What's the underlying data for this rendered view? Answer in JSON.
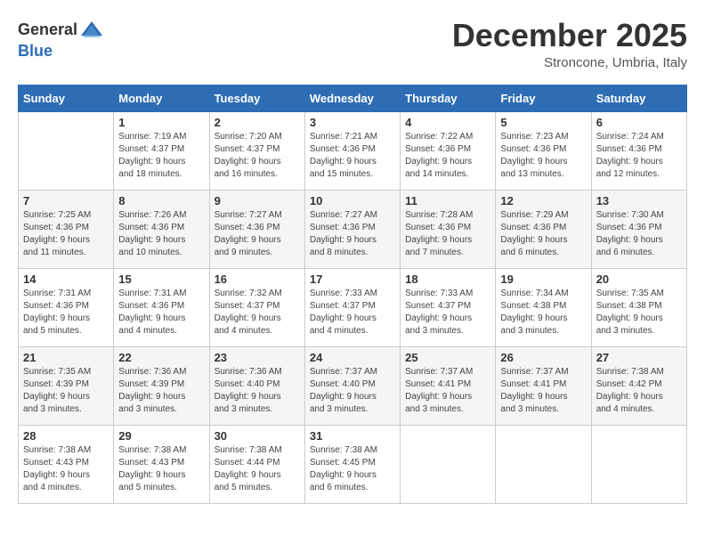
{
  "header": {
    "logo_general": "General",
    "logo_blue": "Blue",
    "month_title": "December 2025",
    "location": "Stroncone, Umbria, Italy"
  },
  "days_of_week": [
    "Sunday",
    "Monday",
    "Tuesday",
    "Wednesday",
    "Thursday",
    "Friday",
    "Saturday"
  ],
  "weeks": [
    [
      {
        "day": "",
        "content": ""
      },
      {
        "day": "1",
        "content": "Sunrise: 7:19 AM\nSunset: 4:37 PM\nDaylight: 9 hours\nand 18 minutes."
      },
      {
        "day": "2",
        "content": "Sunrise: 7:20 AM\nSunset: 4:37 PM\nDaylight: 9 hours\nand 16 minutes."
      },
      {
        "day": "3",
        "content": "Sunrise: 7:21 AM\nSunset: 4:36 PM\nDaylight: 9 hours\nand 15 minutes."
      },
      {
        "day": "4",
        "content": "Sunrise: 7:22 AM\nSunset: 4:36 PM\nDaylight: 9 hours\nand 14 minutes."
      },
      {
        "day": "5",
        "content": "Sunrise: 7:23 AM\nSunset: 4:36 PM\nDaylight: 9 hours\nand 13 minutes."
      },
      {
        "day": "6",
        "content": "Sunrise: 7:24 AM\nSunset: 4:36 PM\nDaylight: 9 hours\nand 12 minutes."
      }
    ],
    [
      {
        "day": "7",
        "content": "Sunrise: 7:25 AM\nSunset: 4:36 PM\nDaylight: 9 hours\nand 11 minutes."
      },
      {
        "day": "8",
        "content": "Sunrise: 7:26 AM\nSunset: 4:36 PM\nDaylight: 9 hours\nand 10 minutes."
      },
      {
        "day": "9",
        "content": "Sunrise: 7:27 AM\nSunset: 4:36 PM\nDaylight: 9 hours\nand 9 minutes."
      },
      {
        "day": "10",
        "content": "Sunrise: 7:27 AM\nSunset: 4:36 PM\nDaylight: 9 hours\nand 8 minutes."
      },
      {
        "day": "11",
        "content": "Sunrise: 7:28 AM\nSunset: 4:36 PM\nDaylight: 9 hours\nand 7 minutes."
      },
      {
        "day": "12",
        "content": "Sunrise: 7:29 AM\nSunset: 4:36 PM\nDaylight: 9 hours\nand 6 minutes."
      },
      {
        "day": "13",
        "content": "Sunrise: 7:30 AM\nSunset: 4:36 PM\nDaylight: 9 hours\nand 6 minutes."
      }
    ],
    [
      {
        "day": "14",
        "content": "Sunrise: 7:31 AM\nSunset: 4:36 PM\nDaylight: 9 hours\nand 5 minutes."
      },
      {
        "day": "15",
        "content": "Sunrise: 7:31 AM\nSunset: 4:36 PM\nDaylight: 9 hours\nand 4 minutes."
      },
      {
        "day": "16",
        "content": "Sunrise: 7:32 AM\nSunset: 4:37 PM\nDaylight: 9 hours\nand 4 minutes."
      },
      {
        "day": "17",
        "content": "Sunrise: 7:33 AM\nSunset: 4:37 PM\nDaylight: 9 hours\nand 4 minutes."
      },
      {
        "day": "18",
        "content": "Sunrise: 7:33 AM\nSunset: 4:37 PM\nDaylight: 9 hours\nand 3 minutes."
      },
      {
        "day": "19",
        "content": "Sunrise: 7:34 AM\nSunset: 4:38 PM\nDaylight: 9 hours\nand 3 minutes."
      },
      {
        "day": "20",
        "content": "Sunrise: 7:35 AM\nSunset: 4:38 PM\nDaylight: 9 hours\nand 3 minutes."
      }
    ],
    [
      {
        "day": "21",
        "content": "Sunrise: 7:35 AM\nSunset: 4:39 PM\nDaylight: 9 hours\nand 3 minutes."
      },
      {
        "day": "22",
        "content": "Sunrise: 7:36 AM\nSunset: 4:39 PM\nDaylight: 9 hours\nand 3 minutes."
      },
      {
        "day": "23",
        "content": "Sunrise: 7:36 AM\nSunset: 4:40 PM\nDaylight: 9 hours\nand 3 minutes."
      },
      {
        "day": "24",
        "content": "Sunrise: 7:37 AM\nSunset: 4:40 PM\nDaylight: 9 hours\nand 3 minutes."
      },
      {
        "day": "25",
        "content": "Sunrise: 7:37 AM\nSunset: 4:41 PM\nDaylight: 9 hours\nand 3 minutes."
      },
      {
        "day": "26",
        "content": "Sunrise: 7:37 AM\nSunset: 4:41 PM\nDaylight: 9 hours\nand 3 minutes."
      },
      {
        "day": "27",
        "content": "Sunrise: 7:38 AM\nSunset: 4:42 PM\nDaylight: 9 hours\nand 4 minutes."
      }
    ],
    [
      {
        "day": "28",
        "content": "Sunrise: 7:38 AM\nSunset: 4:43 PM\nDaylight: 9 hours\nand 4 minutes."
      },
      {
        "day": "29",
        "content": "Sunrise: 7:38 AM\nSunset: 4:43 PM\nDaylight: 9 hours\nand 5 minutes."
      },
      {
        "day": "30",
        "content": "Sunrise: 7:38 AM\nSunset: 4:44 PM\nDaylight: 9 hours\nand 5 minutes."
      },
      {
        "day": "31",
        "content": "Sunrise: 7:38 AM\nSunset: 4:45 PM\nDaylight: 9 hours\nand 6 minutes."
      },
      {
        "day": "",
        "content": ""
      },
      {
        "day": "",
        "content": ""
      },
      {
        "day": "",
        "content": ""
      }
    ]
  ]
}
